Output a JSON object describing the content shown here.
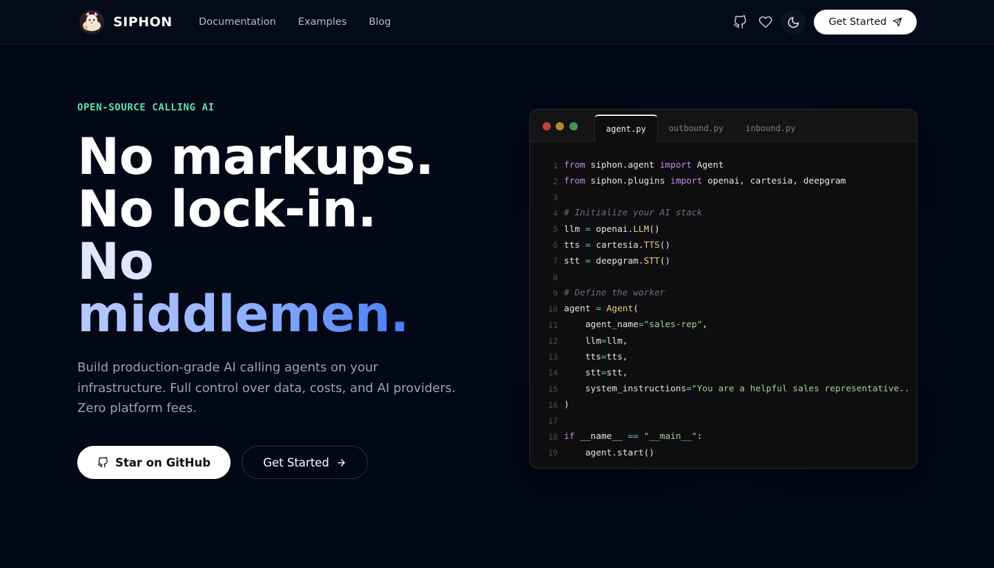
{
  "nav": {
    "brand": "SIPHON",
    "links": [
      "Documentation",
      "Examples",
      "Blog"
    ],
    "cta": "Get Started",
    "icons": [
      "github-icon",
      "heart-icon",
      "moon-icon",
      "send-icon"
    ]
  },
  "hero": {
    "eyebrow": "OPEN-SOURCE CALLING AI",
    "headline": {
      "line1": "No markups.",
      "line2": "No lock-in.",
      "line3": "No",
      "line4": "middlemen."
    },
    "subtitle": "Build production-grade AI calling agents on your infrastructure. Full control over data, costs, and AI providers. Zero platform fees.",
    "primary_button": "Star on GitHub",
    "secondary_button": "Get Started"
  },
  "editor": {
    "tabs": [
      "agent.py",
      "outbound.py",
      "inbound.py"
    ],
    "active_tab": "agent.py",
    "lines": [
      "from siphon.agent import Agent",
      "from siphon.plugins import openai, cartesia, deepgram",
      "",
      "# Initialize your AI stack",
      "llm = openai.LLM()",
      "tts = cartesia.TTS()",
      "stt = deepgram.STT()",
      "",
      "# Define the worker",
      "agent = Agent(",
      "    agent_name=\"sales-rep\",",
      "    llm=llm,",
      "    tts=tts,",
      "    stt=stt,",
      "    system_instructions=\"You are a helpful sales representative..",
      ")",
      "",
      "if __name__ == \"__main__\":",
      "    agent.start()"
    ]
  },
  "colors": {
    "background": "#030817",
    "accent_green": "#5fe0a8",
    "accent_blue": "#4a80f5"
  }
}
